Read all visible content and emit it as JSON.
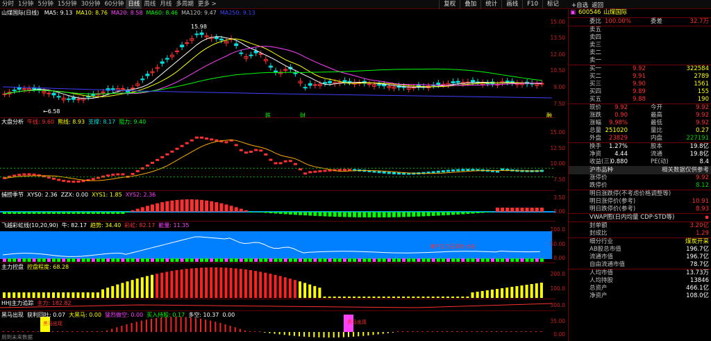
{
  "toolbar": {
    "tabs": [
      "分时",
      "1分钟",
      "5分钟",
      "15分钟",
      "30分钟",
      "60分钟",
      "日线",
      "周线",
      "月线",
      "多周期",
      "更多 >"
    ],
    "active_index": 6,
    "right_tools": [
      "复权",
      "叠加",
      "统计",
      "画线",
      "F10",
      "标记"
    ],
    "self_select": "+自选",
    "back": "返回"
  },
  "main": {
    "title": "山煤国际(日线)",
    "ma": [
      {
        "label": "MA5: 9.13",
        "color": "#ffffff"
      },
      {
        "label": "MA10: 8.76",
        "color": "#ffff00"
      },
      {
        "label": "MA20: 8.58",
        "color": "#ff40ff"
      },
      {
        "label": "MA60: 8.46",
        "color": "#00ff00"
      },
      {
        "label": "MA120: 9.47",
        "color": "#c0c0c0"
      },
      {
        "label": "MA250: 9.13",
        "color": "#4040ff"
      }
    ],
    "yticks": [
      "15.00",
      "13.50",
      "12.00",
      "10.50",
      "9.00",
      "7.50"
    ],
    "annotations": {
      "high": "15.98",
      "low": "6.58",
      "mark1": "跌",
      "mark2": "财",
      "mark3": "融"
    }
  },
  "p1": {
    "title": "大盘分析",
    "items": [
      {
        "label": "牛线: 9.60",
        "color": "#ff3030"
      },
      {
        "label": "熊线: 8.93",
        "color": "#ffff00"
      },
      {
        "label": "支撑: 8.17",
        "color": "#00e0e0"
      },
      {
        "label": "阻力: 9.40",
        "color": "#00ff00"
      }
    ],
    "yticks": [
      "15.00",
      "12.50",
      "10.00",
      "7.50"
    ]
  },
  "p2": {
    "title": "捕捞季节",
    "items": [
      {
        "label": "XYS0: 2.36",
        "color": "#ffffff"
      },
      {
        "label": "ZZX: 0.00",
        "color": "#ffffff"
      },
      {
        "label": "XYS1: 1.85",
        "color": "#ffff00"
      },
      {
        "label": "XYS2: 2.36",
        "color": "#ff40ff"
      }
    ],
    "yticks": [
      "3.50",
      "0.00"
    ]
  },
  "p3": {
    "title": "飞越彩虹线(10,20,90)",
    "items": [
      {
        "label": "牛: 82.17",
        "color": "#ffffff"
      },
      {
        "label": "趋势: 34.40",
        "color": "#ffff00"
      },
      {
        "label": "彩虹: 82.17",
        "color": "#ff3030"
      },
      {
        "label": "能量: 11.35",
        "color": "#ff40ff"
      }
    ],
    "yticks": [
      "100.0",
      "50.00",
      "0.00"
    ],
    "note": "散户主力无风险·点击"
  },
  "p4": {
    "title": "主力控盘",
    "items": [
      {
        "label": "控盘程度: 68.28",
        "color": "#ffff00"
      }
    ],
    "yticks": [
      "200.0",
      "100.0"
    ]
  },
  "p5": {
    "title": "HHJ主力追踪",
    "items": [
      {
        "label": "主力: 182.82",
        "color": "#ff3030"
      }
    ],
    "yticks": [
      "300.0"
    ]
  },
  "p6": {
    "title": "黑马出现",
    "items": [
      {
        "label": "获利回吐: 0.07",
        "color": "#ffffff"
      },
      {
        "label": "大黑马: 0.00",
        "color": "#ffff00"
      },
      {
        "label": "猛烈做空: 0.00",
        "color": "#ff40ff"
      },
      {
        "label": "买入持股: 0.17",
        "color": "#00ff00"
      },
      {
        "label": "多空: 10.37",
        "color": "#ffffff"
      },
      {
        "label": "0.00",
        "color": "#ffffff"
      }
    ],
    "yticks": [
      "35.00",
      "0.00"
    ],
    "tag1": "黑马出现",
    "tag2": "黑马出现"
  },
  "footer": "用到未来数据",
  "quote": {
    "code": "600546",
    "name": "山煤国际",
    "weibi": {
      "label": "委比",
      "value": "100.00%",
      "label2": "委差",
      "value2": "32.7万"
    },
    "asks": [
      {
        "label": "卖五",
        "price": "",
        "vol": ""
      },
      {
        "label": "卖四",
        "price": "",
        "vol": ""
      },
      {
        "label": "卖三",
        "price": "",
        "vol": ""
      },
      {
        "label": "卖二",
        "price": "",
        "vol": ""
      },
      {
        "label": "卖一",
        "price": "",
        "vol": ""
      }
    ],
    "bids": [
      {
        "label": "买一",
        "price": "9.92",
        "vol": "322584"
      },
      {
        "label": "买二",
        "price": "9.91",
        "vol": "2789"
      },
      {
        "label": "买三",
        "price": "9.90",
        "vol": "1561"
      },
      {
        "label": "买四",
        "price": "9.89",
        "vol": "155"
      },
      {
        "label": "买五",
        "price": "9.88",
        "vol": "190"
      }
    ],
    "stats": [
      {
        "l1": "现价",
        "v1": "9.92",
        "c1": "red",
        "l2": "今开",
        "v2": "9.92",
        "c2": "red"
      },
      {
        "l1": "涨跌",
        "v1": "0.90",
        "c1": "red",
        "l2": "最高",
        "v2": "9.92",
        "c2": "red"
      },
      {
        "l1": "涨幅",
        "v1": "9.98%",
        "c1": "red",
        "l2": "最低",
        "v2": "9.92",
        "c2": "red"
      },
      {
        "l1": "总量",
        "v1": "251020",
        "c1": "yel",
        "l2": "量比",
        "v2": "0.27",
        "c2": "yel"
      },
      {
        "l1": "外盘",
        "v1": "23829",
        "c1": "red",
        "l2": "内盘",
        "v2": "227191",
        "c2": "grn"
      }
    ],
    "stats2": [
      {
        "l1": "换手",
        "v1": "1.27%",
        "l2": "股本",
        "v2": "19.8亿"
      },
      {
        "l1": "净资",
        "v1": "4.44",
        "l2": "流通",
        "v2": "19.8亿"
      },
      {
        "l1": "收益(三)",
        "v1": "0.880",
        "l2": "PE(动)",
        "v2": "8.4"
      }
    ],
    "hbar": {
      "label": "沪市品种",
      "label2": "相关数据仅供参考"
    },
    "limits": [
      {
        "label": "涨停价",
        "value": "9.92",
        "color": "red"
      },
      {
        "label": "跌停价",
        "value": "8.12",
        "color": "grn"
      }
    ],
    "tomorrow": [
      {
        "label": "明日涨跌停(不考虑价格调整等)",
        "value": ""
      },
      {
        "label": "明日涨停价(参考)",
        "value": "10.91"
      },
      {
        "label": "明日跌停价(参考)",
        "value": "8.93"
      }
    ],
    "vwap": "VWAP图(日内均量 CDP·STD等)",
    "fengdan": [
      {
        "label": "封单额",
        "value": "3.20亿"
      },
      {
        "label": "封成比",
        "value": "1.29"
      }
    ],
    "industry": [
      {
        "label": "细分行业",
        "value": "煤炭开采",
        "color": "yel"
      },
      {
        "label": "AB股总市值",
        "value": "196.7亿",
        "color": "wht"
      },
      {
        "label": "流通市值",
        "value": "196.7亿",
        "color": "wht"
      },
      {
        "label": "自由流通市值",
        "value": "78.7亿",
        "color": "wht"
      }
    ],
    "holders": [
      {
        "label": "人均市值",
        "value": "13.73万"
      },
      {
        "label": "人均持股",
        "value": "13846"
      },
      {
        "label": "总资产",
        "value": "466.1亿"
      },
      {
        "label": "净资产",
        "value": "108.0亿"
      }
    ]
  }
}
